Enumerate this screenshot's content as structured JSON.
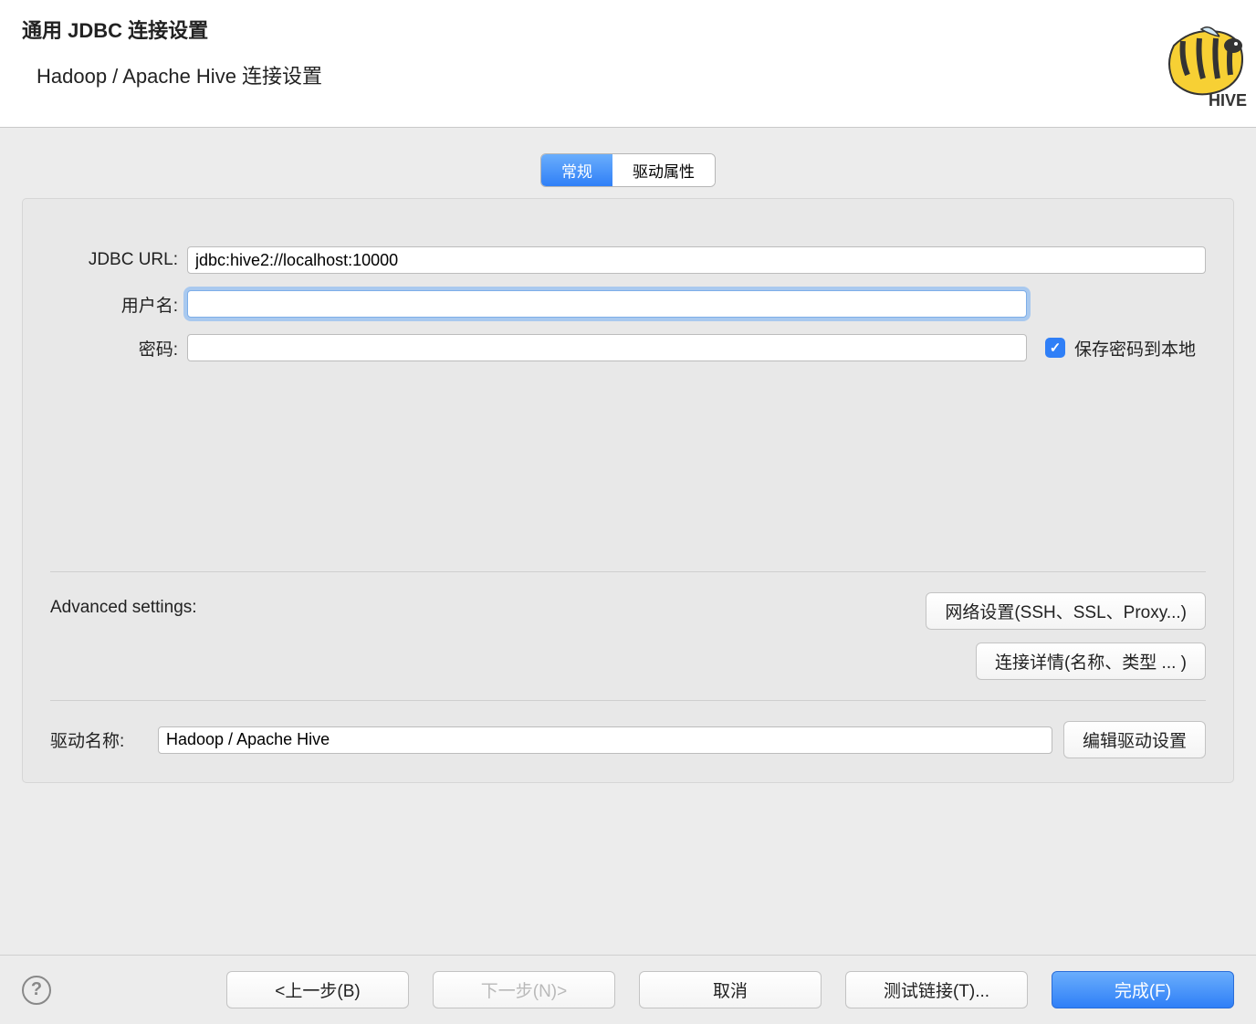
{
  "header": {
    "title": "通用 JDBC 连接设置",
    "subtitle": "Hadoop / Apache Hive 连接设置"
  },
  "tabs": {
    "general": "常规",
    "driver_props": "驱动属性"
  },
  "form": {
    "jdbc_url_label": "JDBC URL:",
    "jdbc_url_value": "jdbc:hive2://localhost:10000",
    "username_label": "用户名:",
    "username_value": "",
    "password_label": "密码:",
    "password_value": "",
    "save_password_label": "保存密码到本地",
    "save_password_checked": true
  },
  "advanced": {
    "label": "Advanced settings:",
    "network_button": "网络设置(SSH、SSL、Proxy...)",
    "details_button": "连接详情(名称、类型 ... )"
  },
  "driver": {
    "label": "驱动名称:",
    "value": "Hadoop / Apache Hive",
    "edit_button": "编辑驱动设置"
  },
  "footer": {
    "back": "<上一步(B)",
    "next": "下一步(N)>",
    "cancel": "取消",
    "test": "测试链接(T)...",
    "finish": "完成(F)"
  }
}
